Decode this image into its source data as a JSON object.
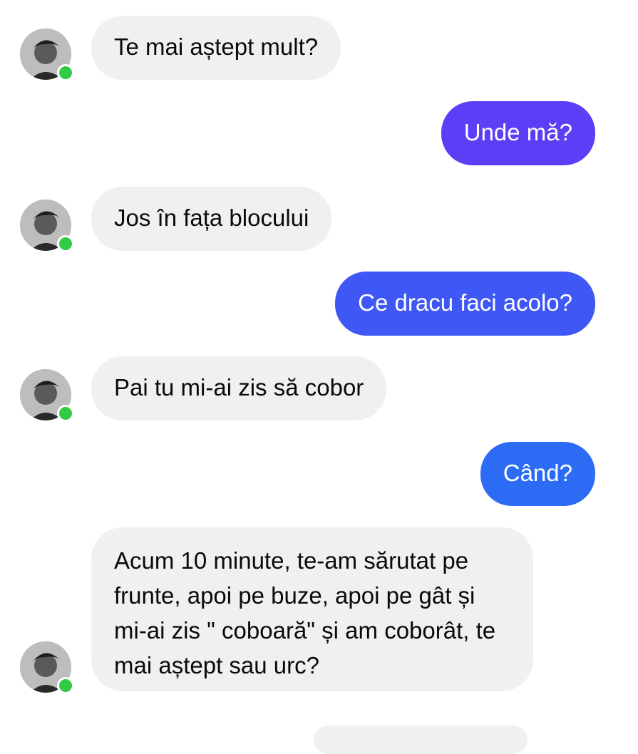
{
  "messages": [
    {
      "id": "m1",
      "direction": "incoming",
      "text": "Te mai aștept mult?",
      "sender_online": true
    },
    {
      "id": "m2",
      "direction": "outgoing",
      "text": "Unde mă?",
      "bubble_color": "#5b3ef6"
    },
    {
      "id": "m3",
      "direction": "incoming",
      "text": "Jos în fața blocului",
      "sender_online": true
    },
    {
      "id": "m4",
      "direction": "outgoing",
      "text": "Ce dracu faci acolo?",
      "bubble_color": "#3f57f5"
    },
    {
      "id": "m5",
      "direction": "incoming",
      "text": "Pai tu mi-ai zis să cobor",
      "sender_online": true
    },
    {
      "id": "m6",
      "direction": "outgoing",
      "text": "Când?",
      "bubble_color": "#2c6cf5"
    },
    {
      "id": "m7",
      "direction": "incoming",
      "text": "Acum 10 minute, te-am sărutat pe frunte, apoi pe buze, apoi pe gât și mi-ai zis \" coboară\" și am coborât, te mai aștept sau urc?",
      "sender_online": true
    }
  ],
  "colors": {
    "incoming_bubble": "#f0f0f0",
    "online_indicator": "#31cc46"
  },
  "icons": {
    "avatar": "contact-avatar",
    "status": "online-status-dot"
  }
}
